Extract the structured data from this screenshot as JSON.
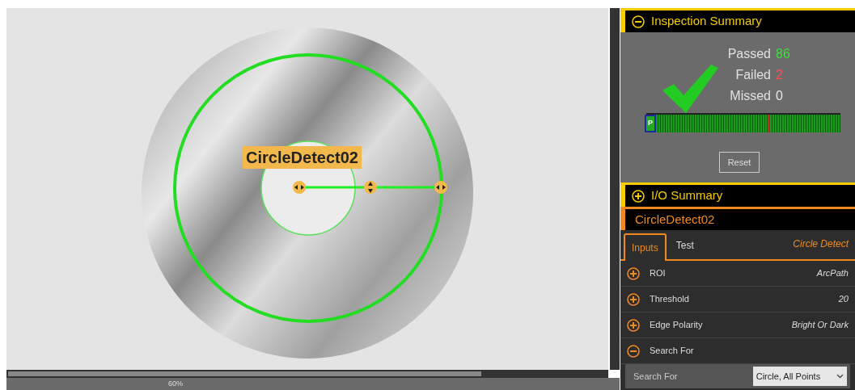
{
  "canvas": {
    "tool_label": "CircleDetect02",
    "zoom": "60%"
  },
  "inspection_summary": {
    "title": "Inspection Summary",
    "expanded": true,
    "counts": [
      {
        "label": "Passed",
        "value": "86",
        "kind": "pass"
      },
      {
        "label": "Failed",
        "value": "2",
        "kind": "fail"
      },
      {
        "label": "Missed",
        "value": "0",
        "kind": "miss"
      }
    ],
    "marker": "P",
    "reset": "Reset"
  },
  "io_summary": {
    "title": "I/O Summary",
    "expanded": false
  },
  "tool": {
    "name": "CircleDetect02",
    "type": "Circle Detect",
    "tabs": [
      {
        "label": "Inputs",
        "selected": true
      },
      {
        "label": "Test",
        "selected": false
      }
    ],
    "params": [
      {
        "label": "ROI",
        "value": "ArcPath",
        "expanded": false
      },
      {
        "label": "Threshold",
        "value": "20",
        "expanded": false
      },
      {
        "label": "Edge Polarity",
        "value": "Bright Or Dark",
        "expanded": false
      },
      {
        "label": "Search For",
        "expanded": true
      }
    ],
    "sub_field": {
      "label": "Search For",
      "value": "Circle, All Points"
    }
  }
}
